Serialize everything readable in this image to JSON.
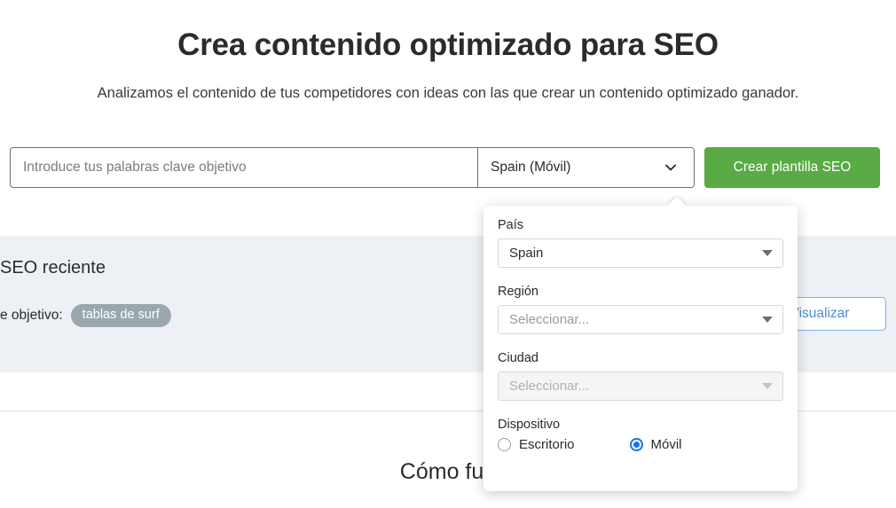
{
  "hero": {
    "title": "Crea contenido optimizado para SEO",
    "subtitle": "Analizamos el contenido de tus competidores con ideas con las que crear un contenido optimizado ganador."
  },
  "search": {
    "keyword_placeholder": "Introduce tus palabras clave objetivo",
    "keyword_value": "",
    "location_label": "Spain (Móvil)",
    "cta_label": "Crear plantilla SEO"
  },
  "recent": {
    "title": "SEO reciente",
    "target_label": "e objetivo:",
    "tag": "tablas de surf",
    "view_button": "Visualizar"
  },
  "how_section": {
    "title": "Cómo fun"
  },
  "popover": {
    "country": {
      "label": "País",
      "value": "Spain"
    },
    "region": {
      "label": "Región",
      "value": "Seleccionar..."
    },
    "city": {
      "label": "Ciudad",
      "value": "Seleccionar..."
    },
    "device": {
      "label": "Dispositivo",
      "options": [
        {
          "label": "Escritorio",
          "selected": false
        },
        {
          "label": "Móvil",
          "selected": true
        }
      ]
    }
  },
  "colors": {
    "cta_green": "#5aaa46",
    "panel_bg": "#edf1f6",
    "tag_bg": "#9aa8ad",
    "radio_accent": "#1a73e8",
    "outline_blue": "#4a90d9"
  }
}
